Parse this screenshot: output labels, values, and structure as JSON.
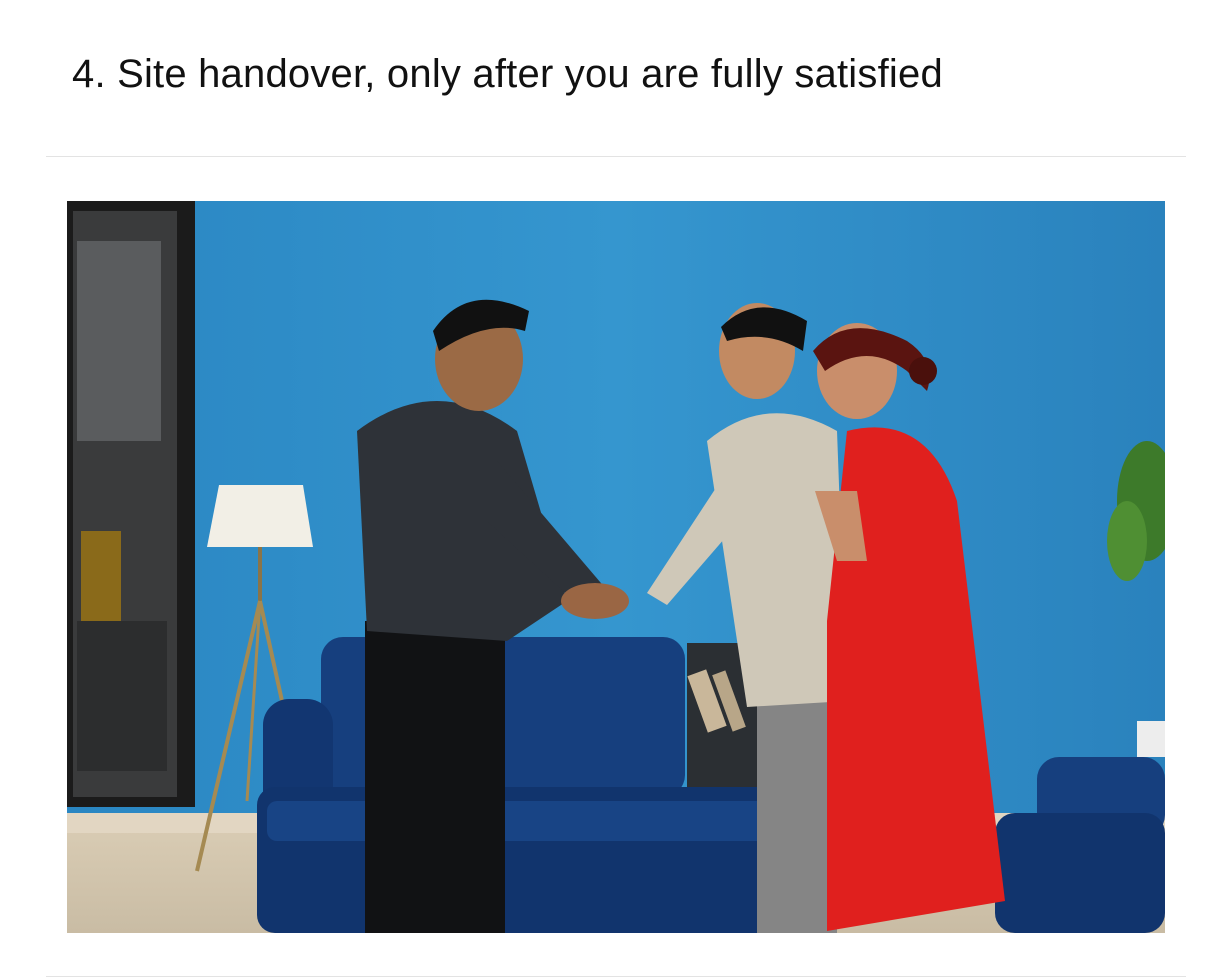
{
  "section": {
    "title": "4. Site handover, only after you are fully satisfied"
  },
  "photo": {
    "subject": "handover-handshake-photo",
    "colors": {
      "wall": "#2f8fc9",
      "sofa": "#123a78",
      "kurta": "#e0201e",
      "shirt_dark": "#2e3238",
      "shirt_light": "#cfc8b8",
      "floor": "#d9cbb4"
    }
  }
}
